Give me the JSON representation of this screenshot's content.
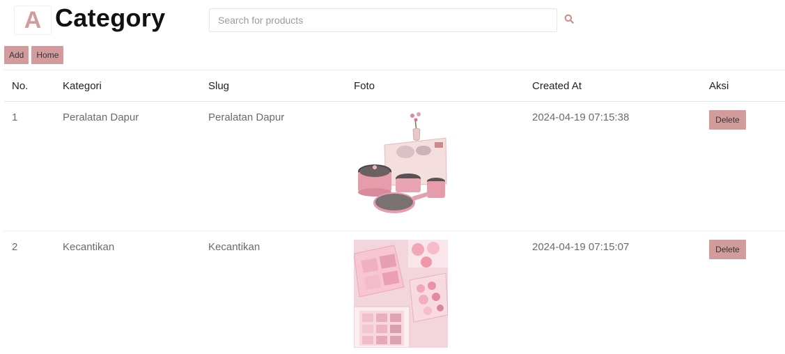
{
  "header": {
    "logo_letter": "A",
    "title": "Category",
    "search_placeholder": "Search for products",
    "search_icon": "search-icon"
  },
  "toolbar": {
    "add_label": "Add",
    "home_label": "Home"
  },
  "table": {
    "columns": [
      "No.",
      "Kategori",
      "Slug",
      "Foto",
      "Created At",
      "Aksi"
    ],
    "rows": [
      {
        "no": "1",
        "kategori": "Peralatan Dapur",
        "slug": "Peralatan Dapur",
        "foto": "pink-cookware-set-image",
        "created_at": "2024-04-19 07:15:38",
        "action_label": "Delete"
      },
      {
        "no": "2",
        "kategori": "Kecantikan",
        "slug": "Kecantikan",
        "foto": "pink-makeup-palettes-image",
        "created_at": "2024-04-19 07:15:07",
        "action_label": "Delete"
      }
    ]
  },
  "colors": {
    "accent": "#d39c9c",
    "logo": "#d39c9c",
    "text_muted": "#6b6b6b"
  }
}
